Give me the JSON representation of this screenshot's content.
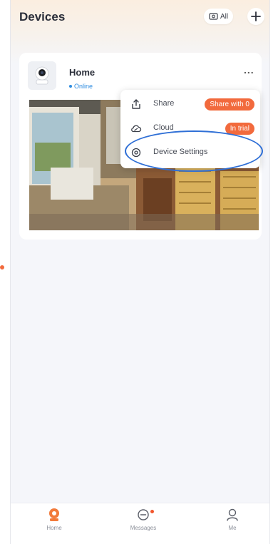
{
  "header": {
    "title": "Devices",
    "filter_label": "All",
    "add_icon": "plus-icon"
  },
  "device": {
    "name": "Home",
    "status": "Online",
    "more_label": "..."
  },
  "menu": {
    "items": [
      {
        "label": "Share",
        "icon": "share-icon",
        "pill": "Share with 0"
      },
      {
        "label": "Cloud",
        "icon": "cloud-icon",
        "pill": "In trial"
      },
      {
        "label": "Device Settings",
        "icon": "settings-icon",
        "pill": ""
      }
    ]
  },
  "nav": {
    "items": [
      {
        "label": "Home",
        "icon": "home-camera-icon"
      },
      {
        "label": "Messages",
        "icon": "message-icon"
      },
      {
        "label": "Me",
        "icon": "profile-icon"
      }
    ]
  },
  "colors": {
    "accent": "#f26a3d",
    "online": "#2e8ce0",
    "highlight_ring": "#2f6fd6"
  }
}
